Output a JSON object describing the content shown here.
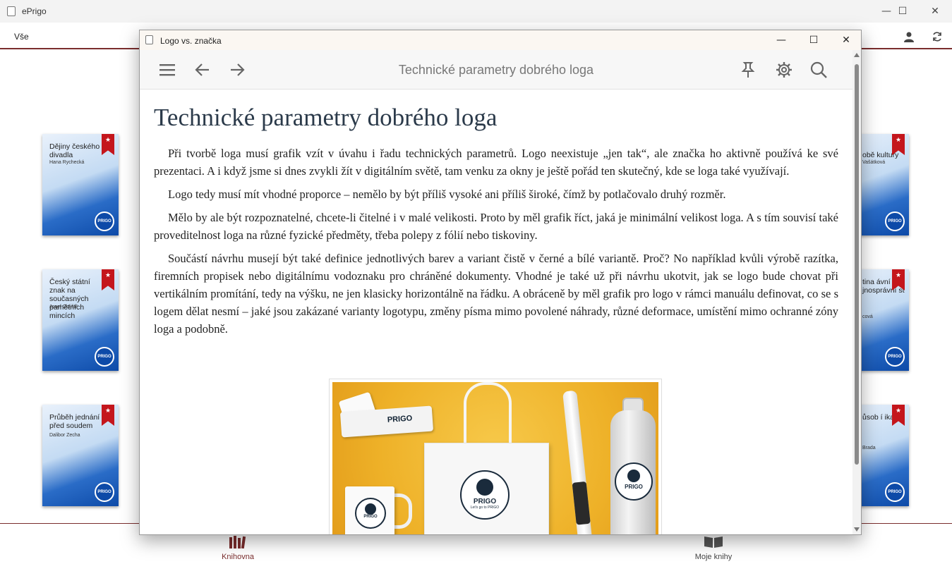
{
  "app": {
    "title": "ePrigo",
    "minimize": "—",
    "maximize": "☐",
    "close": "✕"
  },
  "topbar": {
    "filter_label": "Vše"
  },
  "library": {
    "books_left": [
      {
        "title": "Dějiny českého divadla",
        "author": "Hana Rychecká"
      },
      {
        "title": "Český státní znak na současných pamětních mincích",
        "author": "Josef Oplištil"
      },
      {
        "title": "Průběh jednání před soudem",
        "author": "Dalibor Zecha"
      }
    ],
    "books_right": [
      {
        "title": "obě kultury",
        "author": "Vašátková"
      },
      {
        "title": "tina ávní jnosprávní st",
        "author": "cová"
      },
      {
        "title": "ůsob í ikace",
        "author": "Brada"
      }
    ],
    "book_badge": "★",
    "book_logo": "PRIGO"
  },
  "bottom_nav": {
    "items": [
      {
        "label": "Knihovna",
        "icon": "library-icon",
        "color": "#7a2d2d"
      },
      {
        "label": "Moje knihy",
        "icon": "book-open-icon",
        "color": "#444444"
      }
    ]
  },
  "reader": {
    "window_title": "Logo vs. značka",
    "toolbar": {
      "chapter_title": "Technické parametry dobrého loga",
      "buttons": [
        "menu-icon",
        "arrow-left-icon",
        "arrow-right-icon",
        "pin-icon",
        "gear-icon",
        "search-icon"
      ]
    },
    "article": {
      "heading": "Technické parametry dobrého loga",
      "paragraphs": [
        "Při tvorbě loga musí grafik vzít v úvahu i řadu technických parametrů. Logo neexistuje „jen tak“, ale značka ho aktivně používá ke své prezentaci. A i když jsme si dnes zvykli žít v digitálním světě, tam venku za okny je ještě pořád ten skutečný, kde se loga také využívají.",
        "Logo tedy musí mít vhodné proporce – nemělo by být příliš vysoké ani příliš široké, čímž by potlačovalo druhý rozměr.",
        "Mělo by ale být rozpoznatelné, chcete-li čitelné i v malé velikosti. Proto by měl grafik říct, jaká je minimální velikost loga. A s tím souvisí také proveditelnost loga na různé fyzické předměty, třeba polepy z fólií nebo tiskoviny.",
        "Součástí návrhu musejí být také definice jednotlivých barev a variant čistě v černé a bílé variantě. Proč? No například kvůli výrobě razítka, firemních propisek nebo digitálnímu vodoznaku pro chráněné dokumenty. Vhodné je také už při návrhu ukotvit, jak se logo bude chovat při vertikálním promítání, tedy na výšku, ne jen klasicky horizontálně na řádku. A obráceně by měl grafik pro logo v rámci manuálu definovat, co se s logem dělat nesmí – jaké jsou zakázané varianty logotypu, změny písma mimo povolené náhrady, různé deformace, umístění mimo ochranné zóny loga a podobně."
      ]
    },
    "figure": {
      "brand": "PRIGO",
      "tagline": "Let's go to PRIGO"
    }
  },
  "colors": {
    "accent": "#7a2d2d",
    "book_blue": "#0d4aa8",
    "ribbon": "#c4161c"
  }
}
